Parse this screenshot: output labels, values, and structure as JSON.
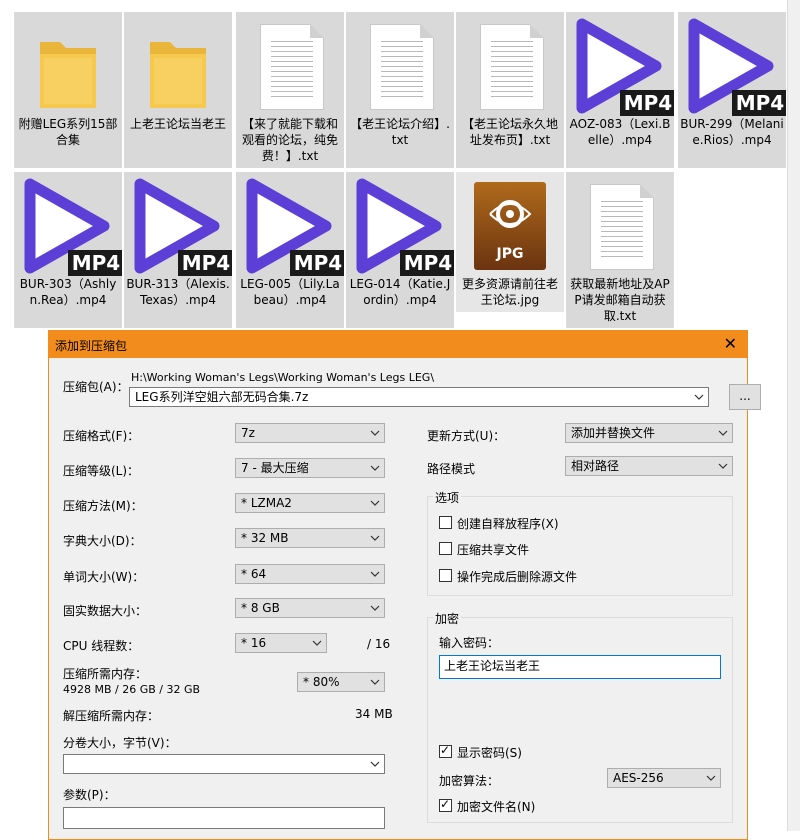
{
  "files": [
    {
      "name": "附赠LEG系列15部合集",
      "type": "folder"
    },
    {
      "name": "上老王论坛当老王",
      "type": "folder"
    },
    {
      "name": "【来了就能下载和观看的论坛，纯免费！】.txt",
      "type": "txt"
    },
    {
      "name": "【老王论坛介绍】.txt",
      "type": "txt"
    },
    {
      "name": "【老王论坛永久地址发布页】.txt",
      "type": "txt"
    },
    {
      "name": "AOZ-083（Lexi.Belle）.mp4",
      "type": "mp4"
    },
    {
      "name": "BUR-299（Melanie.Rios）.mp4",
      "type": "mp4"
    },
    {
      "name": "BUR-303（Ashlyn.Rea）.mp4",
      "type": "mp4"
    },
    {
      "name": "BUR-313（Alexis.Texas）.mp4",
      "type": "mp4"
    },
    {
      "name": "LEG-005（Lily.Labeau）.mp4",
      "type": "mp4"
    },
    {
      "name": "LEG-014（Katie.Jordin）.mp4",
      "type": "mp4"
    },
    {
      "name": "更多资源请前往老王论坛.jpg",
      "type": "jpg"
    },
    {
      "name": "获取最新地址及APP请发邮箱自动获取.txt",
      "type": "txt"
    }
  ],
  "icon_badges": {
    "mp4": "MP4",
    "jpg": "JPG"
  },
  "colors": {
    "accent": "#f28c1c",
    "play": "#5b3fd6",
    "tile": "#d9d9d9",
    "folder": "#f6c94e"
  },
  "dialog": {
    "title": "添加到压缩包",
    "close": "✕",
    "archive_label": "压缩包(A)：",
    "archive_path": "H:\\Working Woman's Legs\\Working Woman's Legs LEG\\",
    "archive_name": "LEG系列洋空姐六部无码合集.7z",
    "browse": "...",
    "format_label": "压缩格式(F)：",
    "format_value": "7z",
    "level_label": "压缩等级(L)：",
    "level_value": "7 - 最大压缩",
    "method_label": "压缩方法(M)：",
    "method_value": "* LZMA2",
    "dict_label": "字典大小(D)：",
    "dict_value": "* 32 MB",
    "word_label": "单词大小(W)：",
    "word_value": "* 64",
    "solid_label": "固实数据大小：",
    "solid_value": "* 8 GB",
    "cpu_label": "CPU 线程数：",
    "cpu_value": "* 16",
    "cpu_total": "/ 16",
    "mem_label": "压缩所需内存：",
    "mem_value": "4928 MB / 26 GB / 32 GB",
    "mem_pct": "* 80%",
    "demem_label": "解压缩所需内存：",
    "demem_value": "34 MB",
    "split_label": "分卷大小，字节(V)：",
    "params_label": "参数(P)：",
    "update_label": "更新方式(U)：",
    "update_value": "添加并替换文件",
    "path_label": "路径模式",
    "path_value": "相对路径",
    "options_title": "选项",
    "opt_sfx": "创建自释放程序(X)",
    "opt_shared": "压缩共享文件",
    "opt_delete": "操作完成后删除源文件",
    "enc_title": "加密",
    "pwd_label": "输入密码：",
    "pwd_value": "上老王论坛当老王",
    "show_pwd": "显示密码(S)",
    "enc_method_label": "加密算法：",
    "enc_method_value": "AES-256",
    "enc_names": "加密文件名(N)"
  }
}
